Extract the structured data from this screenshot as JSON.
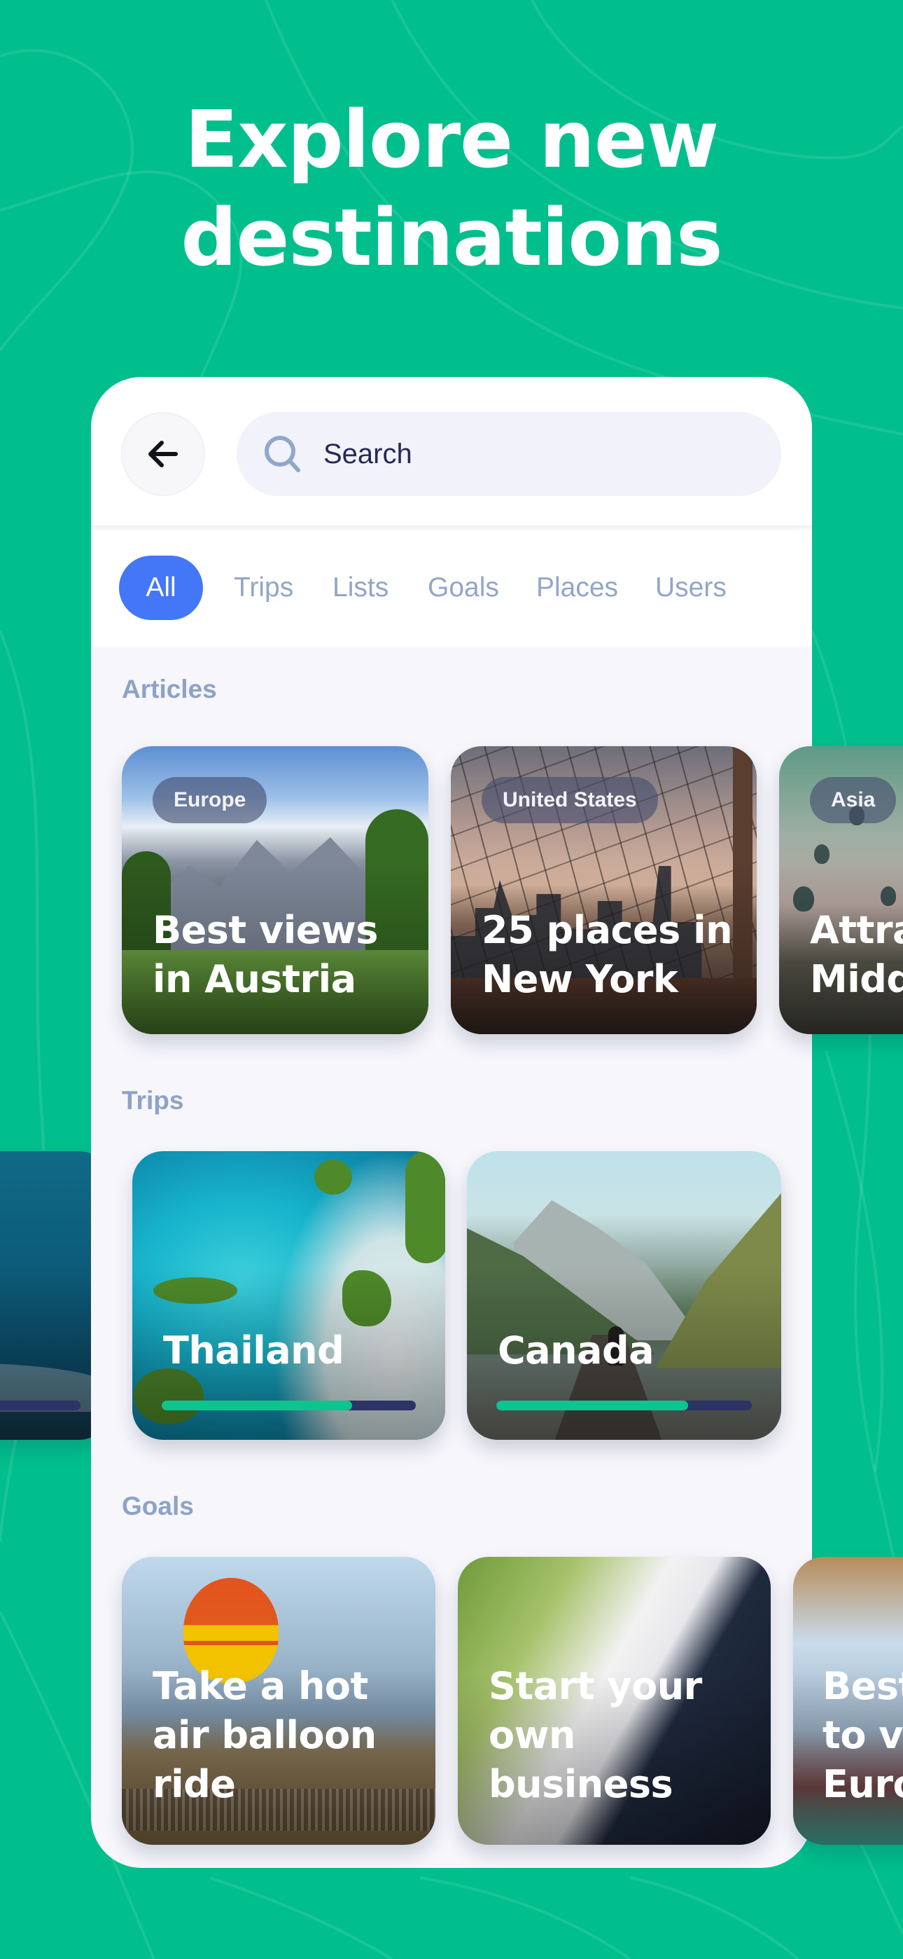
{
  "hero": {
    "title_line1": "Explore new",
    "title_line2": "destinations"
  },
  "colors": {
    "background": "#00BF8C",
    "accent_blue": "#4377F7",
    "muted_label": "#8DA2C6",
    "progress_fill": "#0FC38E",
    "progress_track": "#2C3366"
  },
  "header": {
    "back_icon": "arrow-left-icon",
    "search": {
      "icon": "search-icon",
      "placeholder": "Search"
    }
  },
  "filters": {
    "tabs": [
      {
        "label": "All",
        "active": true
      },
      {
        "label": "Trips",
        "active": false
      },
      {
        "label": "Lists",
        "active": false
      },
      {
        "label": "Goals",
        "active": false
      },
      {
        "label": "Places",
        "active": false
      },
      {
        "label": "Users",
        "active": false
      }
    ]
  },
  "sections": {
    "articles": {
      "label": "Articles",
      "items": [
        {
          "region": "Europe",
          "title_line1": "Best views",
          "title_line2": "in Austria"
        },
        {
          "region": "United States",
          "title_line1": "25 places in",
          "title_line2": "New York"
        },
        {
          "region": "Asia",
          "title_line1": "Attra",
          "title_line2": "Midd"
        }
      ]
    },
    "trips": {
      "label": "Trips",
      "items": [
        {
          "title": "",
          "progress": 0.25
        },
        {
          "title": "Thailand",
          "progress": 0.75
        },
        {
          "title": "Canada",
          "progress": 0.75
        }
      ]
    },
    "goals": {
      "label": "Goals",
      "items": [
        {
          "title_lines": [
            "Take a hot",
            "air balloon",
            "ride"
          ]
        },
        {
          "title_lines": [
            "Start your",
            "own",
            "business"
          ]
        },
        {
          "title_lines": [
            "Best",
            "to vi",
            "Euro"
          ]
        }
      ]
    }
  }
}
